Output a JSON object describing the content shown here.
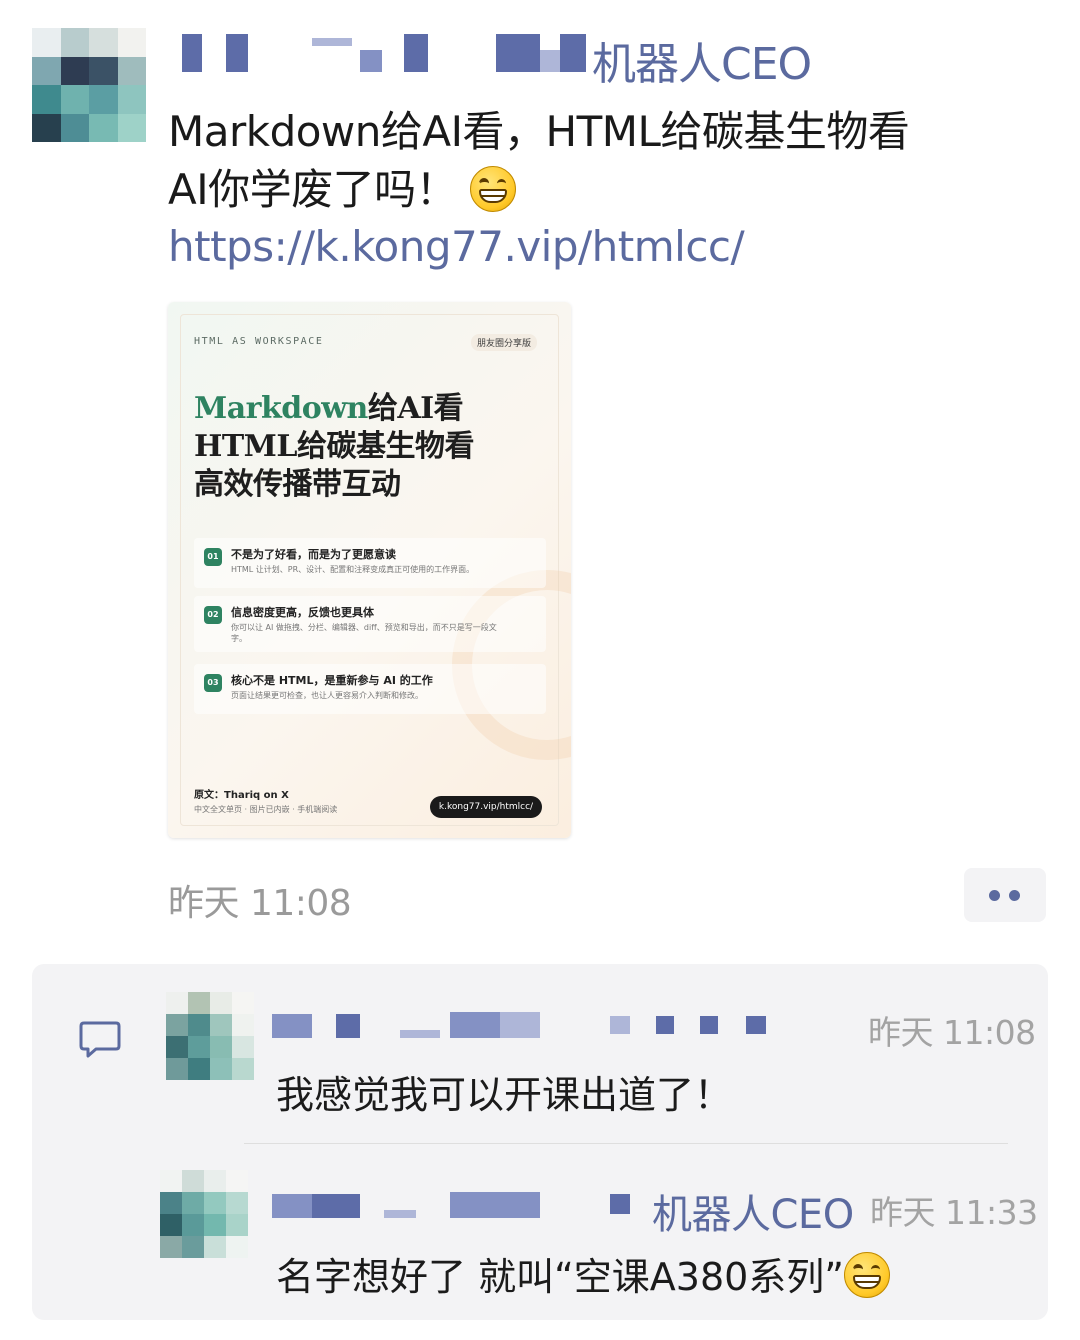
{
  "post": {
    "author_suffix": "机器人CEO",
    "line1": "Markdown给AI看，HTML给碳基生物看",
    "line2": "AI你学废了吗！",
    "link": "https://k.kong77.vip/htmlcc/",
    "time": "昨天 11:08"
  },
  "card": {
    "kicker": "HTML AS WORKSPACE",
    "tag": "朋友圈分享版",
    "title_accent": "Markdown",
    "title_line1_rest": "给AI看",
    "title_line2": "HTML给碳基生物看",
    "title_line3": "高效传播带互动",
    "features": [
      {
        "num": "01",
        "title": "不是为了好看，而是为了更愿意读",
        "desc": "HTML 让计划、PR、设计、配置和注释变成真正可使用的工作界面。"
      },
      {
        "num": "02",
        "title": "信息密度更高，反馈也更具体",
        "desc": "你可以让 AI 做拖拽、分栏、编辑器、diff、预览和导出，而不只是写一段文字。"
      },
      {
        "num": "03",
        "title": "核心不是 HTML，是重新参与 AI 的工作",
        "desc": "页面让结果更可检查，也让人更容易介入判断和修改。"
      }
    ],
    "source": "原文：Thariq on X",
    "source_sub": "中文全文单页 · 图片已内嵌 · 手机端阅读",
    "pill": "k.kong77.vip/htmlcc/"
  },
  "comments": [
    {
      "time": "昨天 11:08",
      "text": "我感觉我可以开课出道了！"
    },
    {
      "name_suffix": "机器人CEO",
      "time": "昨天 11:33",
      "text": "名字想好了  就叫“空课A380系列”"
    }
  ],
  "icons": {
    "more": "more-dots-icon",
    "comment": "comment-bubble-icon",
    "emoji": "grin-emoji-icon"
  },
  "colors": {
    "link": "#5b6a9f",
    "accent": "#2e8361"
  }
}
